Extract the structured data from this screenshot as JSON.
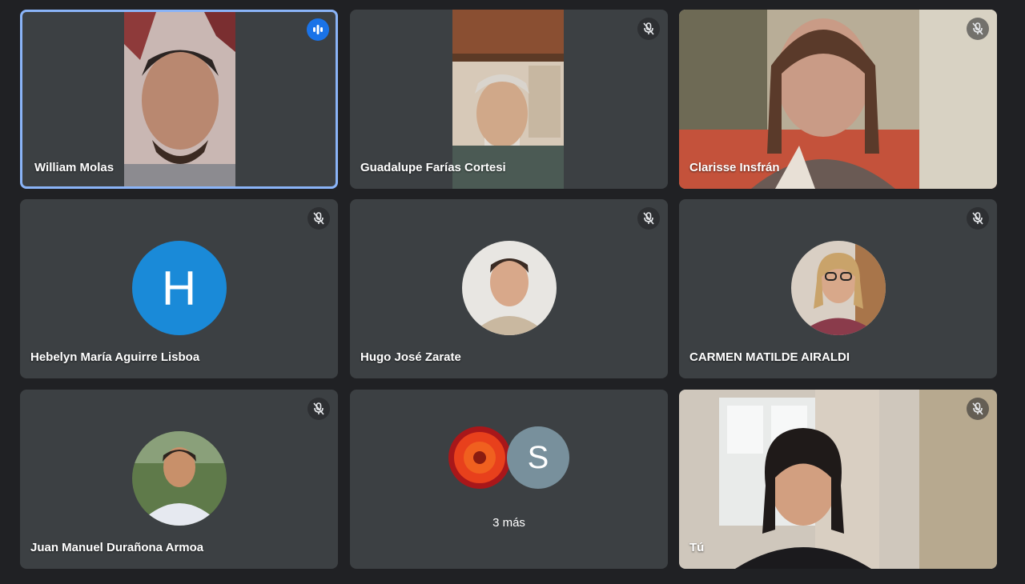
{
  "participants": [
    {
      "name": "William Molas",
      "speaking": true
    },
    {
      "name": "Guadalupe Farías Cortesi",
      "muted": true
    },
    {
      "name": "Clarisse Insfrán",
      "muted": true
    },
    {
      "name": "Hebelyn María Aguirre Lisboa",
      "initial": "H",
      "muted": true
    },
    {
      "name": "Hugo José Zarate",
      "muted": true
    },
    {
      "name": "CARMEN MATILDE AIRALDI",
      "muted": true
    },
    {
      "name": "Juan Manuel Durañona Armoa",
      "muted": true
    },
    {
      "name": "Tú",
      "muted": true
    }
  ],
  "others_tile": {
    "more_label": "3 más",
    "avatar_initial": "S"
  },
  "colors": {
    "background": "#202124",
    "tile": "#3c4043",
    "active_border": "#8ab4f8",
    "speaking": "#1a73e8",
    "letter_avatar": "#1a8ad8"
  }
}
